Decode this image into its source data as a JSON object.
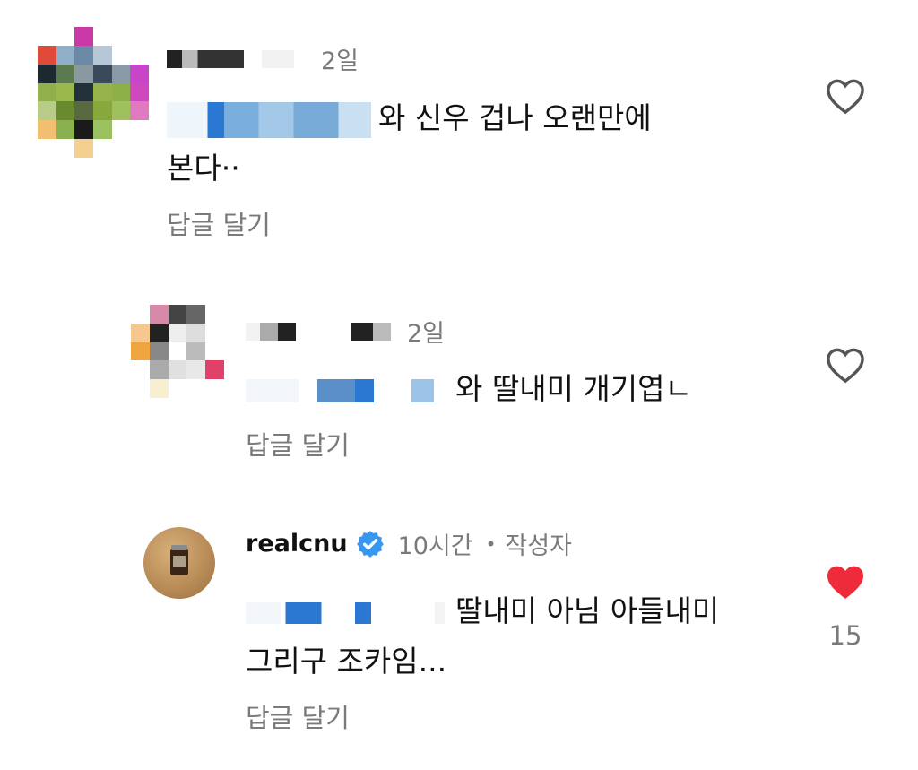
{
  "comments": [
    {
      "time": "2일",
      "text_after_mention": "와 신우 겁나 오랜만에",
      "text_line2": "본다··",
      "reply_label": "답글 달기"
    },
    {
      "time": "2일",
      "text_after_mention": "와 딸내미 개기엽ㄴ",
      "reply_label": "답글 달기"
    },
    {
      "username": "realcnu",
      "verified": true,
      "time": "10시간",
      "separator": "•",
      "author_tag": "작성자",
      "text_after_mention": "딸내미 아님 아들내미",
      "text_line2": "그리구 조카임...",
      "reply_label": "답글 달기",
      "like_count": "15",
      "liked": true
    }
  ],
  "colors": {
    "heart_liked": "#ed2b3a",
    "heart_outline": "#555555",
    "verified_badge": "#3897f0",
    "secondary_text": "#7a7a7a"
  },
  "icons": {
    "like": "heart-icon",
    "liked": "heart-filled-icon",
    "verified": "verified-badge-icon"
  }
}
